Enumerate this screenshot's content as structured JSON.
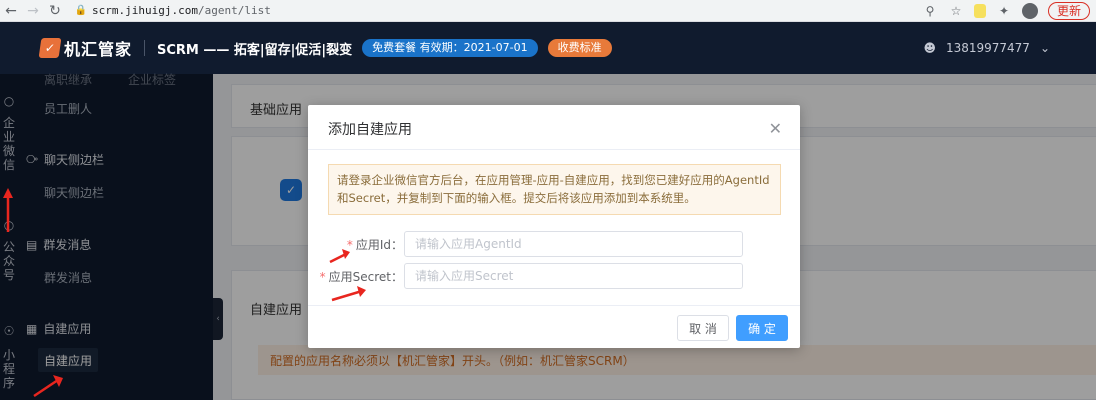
{
  "browser": {
    "url_host": "scrm.jihuigj.com",
    "url_path": "/agent/list",
    "update_label": "更新"
  },
  "header": {
    "logo_text": "机汇管家",
    "product": "SCRM —— 拓客|留存|促活|裂变",
    "plan_badge": "免费套餐  有效期：2021-07-01",
    "pricing_badge": "收费标准",
    "user_phone": "13819977477"
  },
  "rail": {
    "enterprise_wechat": [
      "企",
      "业",
      "微",
      "信"
    ],
    "official_account": [
      "公",
      "众",
      "号"
    ],
    "mini_program": [
      "小",
      "程",
      "序"
    ]
  },
  "sidebar": {
    "top_clipped_left": "离职继承",
    "top_clipped_right": "企业标签",
    "staff_delete": "员工删人",
    "chat_sidebar_section": "聊天侧边栏",
    "chat_sidebar_item": "聊天侧边栏",
    "mass_msg_section": "群发消息",
    "mass_msg_item": "群发消息",
    "custom_app_section": "自建应用",
    "custom_app_item": "自建应用"
  },
  "content": {
    "basic_apps_title": "基础应用",
    "custom_apps_title": "自建应用",
    "warning_text": "配置的应用名称必须以【机汇管家】开头。（例如：机汇管家SCRM）"
  },
  "modal": {
    "title": "添加自建应用",
    "notice_line1": "请登录企业微信官方后台，在应用管理-应用-自建应用，找到您已建好应用的AgentId",
    "notice_line2": "和Secret，并复制到下面的输入框。提交后将该应用添加到本系统里。",
    "agentid_label": "应用Id：",
    "agentid_placeholder": "请输入应用AgentId",
    "secret_label": "应用Secret：",
    "secret_placeholder": "请输入应用Secret",
    "cancel_label": "取 消",
    "ok_label": "确 定"
  },
  "colors": {
    "header_bg": "#101b2e",
    "primary": "#409eff",
    "annotation": "#e8261f"
  }
}
